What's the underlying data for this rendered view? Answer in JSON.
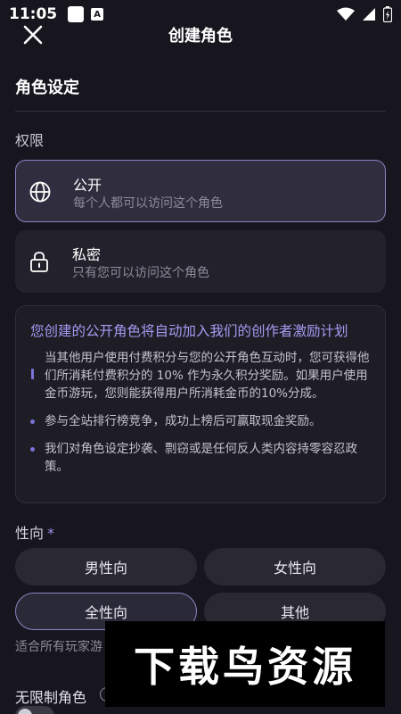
{
  "status_bar": {
    "time": "11:05",
    "badge_letter": "A"
  },
  "header": {
    "title": "创建角色"
  },
  "section": {
    "title": "角色设定"
  },
  "permission": {
    "label": "权限",
    "options": [
      {
        "name": "公开",
        "desc": "每个人都可以访问这个角色",
        "selected": true
      },
      {
        "name": "私密",
        "desc": "只有您可以访问这个角色",
        "selected": false
      }
    ]
  },
  "info": {
    "title": "您创建的公开角色将自动加入我们的创作者激励计划",
    "items": [
      "当其他用户使用付费积分与您的公开角色互动时，您可获得他们所消耗付费积分的 10% 作为永久积分奖励。如果用户使用金币游玩，您则能获得用户所消耗金币的10%分成。",
      "参与全站排行榜竞争，成功上榜后可赢取现金奖励。",
      "我们对角色设定抄袭、剽窃或是任何反人类内容持零容忍政策。"
    ]
  },
  "orientation": {
    "label": "性向",
    "required_mark": "*",
    "options": [
      "男性向",
      "女性向",
      "全性向",
      "其他"
    ],
    "selected": "全性向",
    "helper": "适合所有玩家游"
  },
  "unlimited": {
    "label": "无限制角色",
    "enabled": false
  },
  "watermark": {
    "text": "下载鸟资源"
  },
  "colors": {
    "accent": "#8a85c4",
    "info_title": "#a49bf2",
    "background": "#17161e"
  }
}
